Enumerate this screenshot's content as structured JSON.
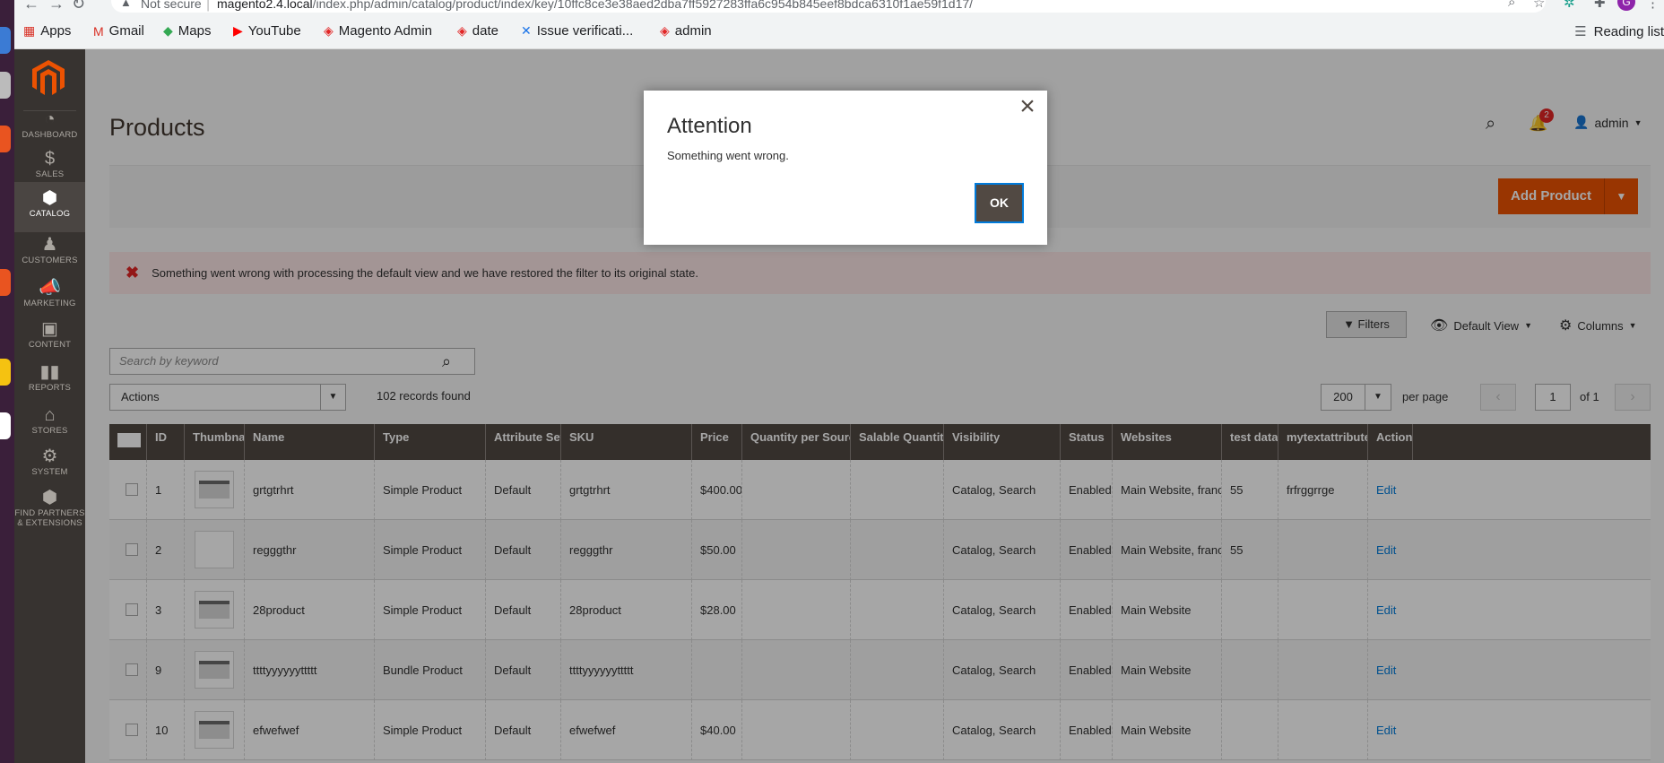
{
  "browser": {
    "not_secure": "Not secure",
    "url_host": "magento2.4.local",
    "url_path": "/index.php/admin/catalog/product/index/key/10ffc8ce3e38aed2dba7ff5927283ffa6c954b845eef8bdca6310f1ae59f1d17/",
    "bookmarks": [
      "Apps",
      "Gmail",
      "Maps",
      "YouTube",
      "Magento Admin",
      "date",
      "Issue verificati...",
      "admin"
    ],
    "reading_list": "Reading list"
  },
  "sidebar": {
    "items": [
      {
        "label": "DASHBOARD",
        "icon": "dashboard-icon"
      },
      {
        "label": "SALES",
        "icon": "dollar-icon"
      },
      {
        "label": "CATALOG",
        "icon": "box-icon"
      },
      {
        "label": "CUSTOMERS",
        "icon": "person-icon"
      },
      {
        "label": "MARKETING",
        "icon": "megaphone-icon"
      },
      {
        "label": "CONTENT",
        "icon": "layout-icon"
      },
      {
        "label": "REPORTS",
        "icon": "bar-chart-icon"
      },
      {
        "label": "STORES",
        "icon": "store-icon"
      },
      {
        "label": "SYSTEM",
        "icon": "gear-icon"
      }
    ],
    "partners_line1": "FIND PARTNERS",
    "partners_line2": "& EXTENSIONS"
  },
  "header": {
    "title": "Products",
    "notification_count": "2",
    "user": "admin"
  },
  "action_bar": {
    "add_product": "Add Product"
  },
  "message": {
    "error": "Something went wrong with processing the default view and we have restored the filter to its original state."
  },
  "toolbar": {
    "filters": "Filters",
    "default_view": "Default View",
    "columns": "Columns",
    "search_placeholder": "Search by keyword",
    "actions": "Actions",
    "records_found": "102 records found",
    "per_page_value": "200",
    "per_page_label": "per page",
    "page_value": "1",
    "page_of": "of 1"
  },
  "grid": {
    "headers": [
      "ID",
      "Thumbnail",
      "Name",
      "Type",
      "Attribute Set",
      "SKU",
      "Price",
      "Quantity per Source",
      "Salable Quantity",
      "Visibility",
      "Status",
      "Websites",
      "test data",
      "mytextattribute",
      "Action"
    ],
    "rows": [
      {
        "id": "1",
        "name": "grtgtrhrt",
        "type": "Simple Product",
        "attribute_set": "Default",
        "sku": "grtgtrhrt",
        "price": "$400.00",
        "visibility": "Catalog, Search",
        "status": "Enabled",
        "websites": "Main Website, france",
        "test_data": "55",
        "mytext": "frfrggrrge",
        "action": "Edit"
      },
      {
        "id": "2",
        "name": "regggthr",
        "type": "Simple Product",
        "attribute_set": "Default",
        "sku": "regggthr",
        "price": "$50.00",
        "visibility": "Catalog, Search",
        "status": "Enabled",
        "websites": "Main Website, france",
        "test_data": "55",
        "mytext": "",
        "action": "Edit"
      },
      {
        "id": "3",
        "name": "28product",
        "type": "Simple Product",
        "attribute_set": "Default",
        "sku": "28product",
        "price": "$28.00",
        "visibility": "Catalog, Search",
        "status": "Enabled",
        "websites": "Main Website",
        "test_data": "",
        "mytext": "",
        "action": "Edit"
      },
      {
        "id": "9",
        "name": "ttttyyyyyyttttt",
        "type": "Bundle Product",
        "attribute_set": "Default",
        "sku": "ttttyyyyyyttttt",
        "price": "",
        "visibility": "Catalog, Search",
        "status": "Enabled",
        "websites": "Main Website",
        "test_data": "",
        "mytext": "",
        "action": "Edit"
      },
      {
        "id": "10",
        "name": "efwefwef",
        "type": "Simple Product",
        "attribute_set": "Default",
        "sku": "efwefwef",
        "price": "$40.00",
        "visibility": "Catalog, Search",
        "status": "Enabled",
        "websites": "Main Website",
        "test_data": "",
        "mytext": "",
        "action": "Edit"
      }
    ]
  },
  "modal": {
    "title": "Attention",
    "text": "Something went wrong.",
    "ok": "OK"
  },
  "colors": {
    "brand_orange": "#eb5202",
    "sidebar_bg": "#373330",
    "grid_header": "#514943",
    "error_bg": "#fae5e5"
  }
}
